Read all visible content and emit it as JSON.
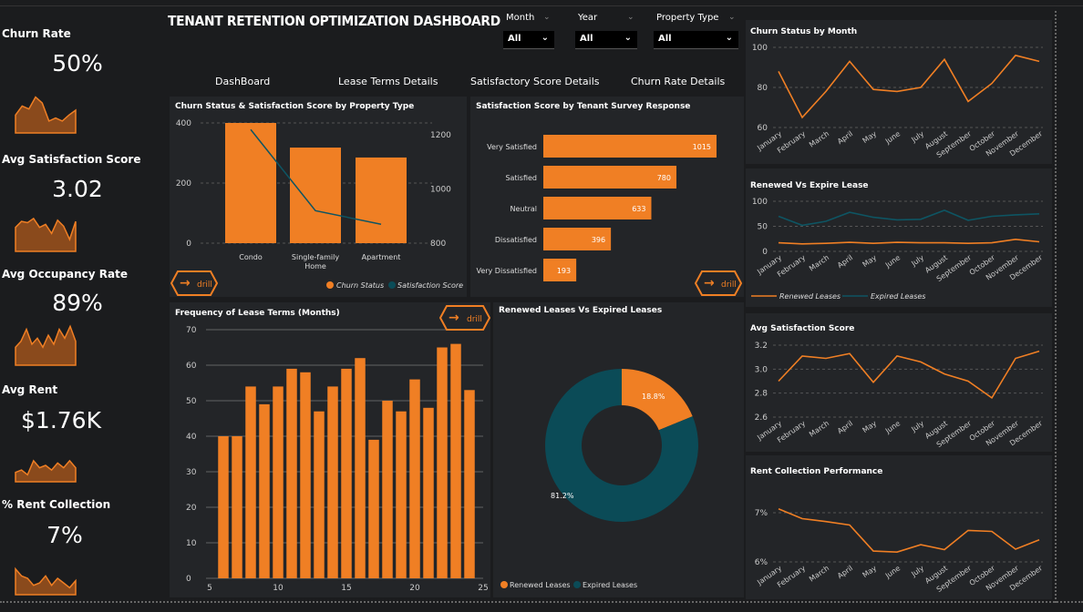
{
  "title": "TENANT RETENTION OPTIMIZATION DASHBOARD",
  "colors": {
    "orange": "#f07f24",
    "teal": "#0b4b57",
    "panel": "#232528",
    "bg": "#1b1c1e"
  },
  "kpis": [
    {
      "label": "Churn Rate",
      "value": "50%",
      "spark": [
        30,
        45,
        40,
        60,
        50,
        20,
        25,
        20,
        30,
        38
      ]
    },
    {
      "label": "Avg Satisfaction Score",
      "value": "3.02",
      "spark": [
        40,
        50,
        48,
        55,
        40,
        45,
        30,
        52,
        42,
        20,
        50
      ]
    },
    {
      "label": "Avg Occupancy Rate",
      "value": "89%",
      "spark": [
        30,
        40,
        60,
        35,
        45,
        30,
        50,
        35,
        60,
        45,
        65,
        40
      ]
    },
    {
      "label": "Avg Rent",
      "value": "$1.76K",
      "spark": [
        20,
        25,
        15,
        45,
        30,
        35,
        25,
        40,
        30,
        45,
        30
      ]
    },
    {
      "label": "% Rent Collection",
      "value": "7%",
      "spark": [
        55,
        40,
        35,
        20,
        25,
        40,
        20,
        35,
        25,
        15,
        30
      ]
    }
  ],
  "slicers": [
    {
      "label": "Month",
      "value": "All"
    },
    {
      "label": "Year",
      "value": "All"
    },
    {
      "label": "Property Type",
      "value": "All"
    }
  ],
  "nav": [
    "DashBoard",
    "Lease Terms Details",
    "Satisfactory Score Details",
    "Churn Rate Details"
  ],
  "drill_label": "drill",
  "churn_by_property": {
    "title": "Churn Status & Satisfaction Score by Property Type",
    "type": "bar",
    "categories": [
      "Condo",
      "Single-family Home",
      "Apartment"
    ],
    "category_lines": [
      [
        "Condo"
      ],
      [
        "Single-family",
        "Home"
      ],
      [
        "Apartment"
      ]
    ],
    "churn": [
      400,
      318,
      285
    ],
    "satisfaction": [
      1220,
      920,
      870
    ],
    "left_ticks": [
      0,
      200,
      400
    ],
    "right_ticks": [
      800,
      1000,
      1200
    ],
    "legend": [
      "Churn Status",
      "Satisfaction Score"
    ]
  },
  "survey": {
    "title": "Satisfaction Score by Tenant Survey Response",
    "type": "bar",
    "categories": [
      "Very Satisfied",
      "Satisfied",
      "Neutral",
      "Dissatisfied",
      "Very Dissatisfied"
    ],
    "values": [
      1015,
      780,
      633,
      396,
      193
    ]
  },
  "lease_freq": {
    "title": "Frequency of Lease Terms (Months)",
    "type": "bar",
    "x": [
      6,
      7,
      8,
      9,
      10,
      11,
      12,
      13,
      14,
      15,
      16,
      17,
      18,
      19,
      20,
      21,
      22,
      23,
      24
    ],
    "values": [
      40,
      40,
      54,
      49,
      54,
      59,
      58,
      47,
      54,
      59,
      62,
      39,
      50,
      47,
      56,
      48,
      65,
      66,
      53
    ],
    "y_ticks": [
      0,
      10,
      20,
      30,
      40,
      50,
      60,
      70
    ],
    "x_ticks": [
      5,
      10,
      15,
      20,
      25
    ]
  },
  "donut": {
    "title": "Renewed Leases Vs Expired Leases",
    "type": "pie",
    "slices": [
      {
        "name": "Renewed Leases",
        "value": 18.8,
        "label": "18.8%"
      },
      {
        "name": "Expired Leases",
        "value": 81.2,
        "label": "81.2%"
      }
    ]
  },
  "months": [
    "January",
    "February",
    "March",
    "April",
    "May",
    "June",
    "July",
    "August",
    "September",
    "October",
    "November",
    "December"
  ],
  "churn_month": {
    "title": "Churn Status by Month",
    "type": "line",
    "values": [
      88,
      65,
      78,
      93,
      79,
      78,
      80,
      94,
      73,
      82,
      96,
      93
    ],
    "y_ticks": [
      60,
      80,
      100
    ]
  },
  "renew_expire": {
    "title": "Renewed Vs Expire Lease",
    "type": "line",
    "series": [
      {
        "name": "Renewed Leases",
        "values": [
          17,
          15,
          16,
          18,
          16,
          18,
          17,
          17,
          16,
          17,
          24,
          19
        ]
      },
      {
        "name": "Expired Leases",
        "values": [
          70,
          52,
          60,
          78,
          68,
          63,
          64,
          82,
          62,
          70,
          73,
          75
        ]
      }
    ],
    "y_ticks": [
      0,
      50,
      100
    ]
  },
  "avg_sat": {
    "title": "Avg Satisfaction Score",
    "type": "line",
    "values": [
      2.9,
      3.11,
      3.09,
      3.13,
      2.89,
      3.11,
      3.06,
      2.96,
      2.9,
      2.76,
      3.09,
      3.15
    ],
    "y_ticks": [
      "2.6",
      "2.8",
      "3.0",
      "3.2"
    ]
  },
  "rent_collection": {
    "title": "Rent Collection Performance",
    "type": "line",
    "values": [
      7.08,
      6.88,
      6.82,
      6.75,
      6.22,
      6.2,
      6.35,
      6.25,
      6.64,
      6.62,
      6.26,
      6.45
    ],
    "y_ticks": [
      "6%",
      "7%"
    ]
  }
}
